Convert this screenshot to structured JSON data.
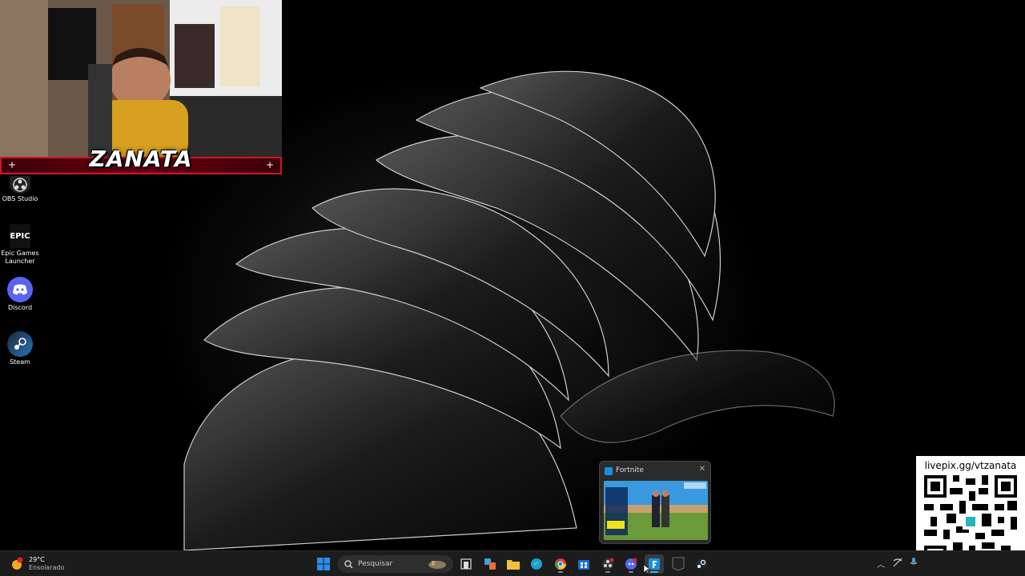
{
  "webcam": {
    "streamer_name": "ZANATA"
  },
  "desktop_icons": [
    {
      "label": "OBS Studio",
      "icon": "obs-icon"
    },
    {
      "label": "Epic Games Launcher",
      "icon": "epic-games-icon"
    },
    {
      "label": "Discord",
      "icon": "discord-icon"
    },
    {
      "label": "Steam",
      "icon": "steam-icon"
    }
  ],
  "epic_logo_text": "EPIC",
  "thumbnail": {
    "title": "Fortnite"
  },
  "livepix": {
    "url": "livepix.gg/vtzanata"
  },
  "taskbar": {
    "weather": {
      "temp": "29°C",
      "desc": "Ensolarado"
    },
    "search_placeholder": "Pesquisar",
    "apps": [
      "start-icon",
      "search-icon",
      "task-view-icon",
      "widgets-icon",
      "file-explorer-icon",
      "edge-icon",
      "chrome-icon",
      "store-icon",
      "obs-icon",
      "discord-icon",
      "fortnite-icon",
      "epic-games-icon",
      "steam-icon"
    ]
  },
  "colors": {
    "taskbar": "#1c1c1c",
    "accent_red": "#d0142c",
    "discord": "#5865f2",
    "steam": "#1b2838"
  }
}
